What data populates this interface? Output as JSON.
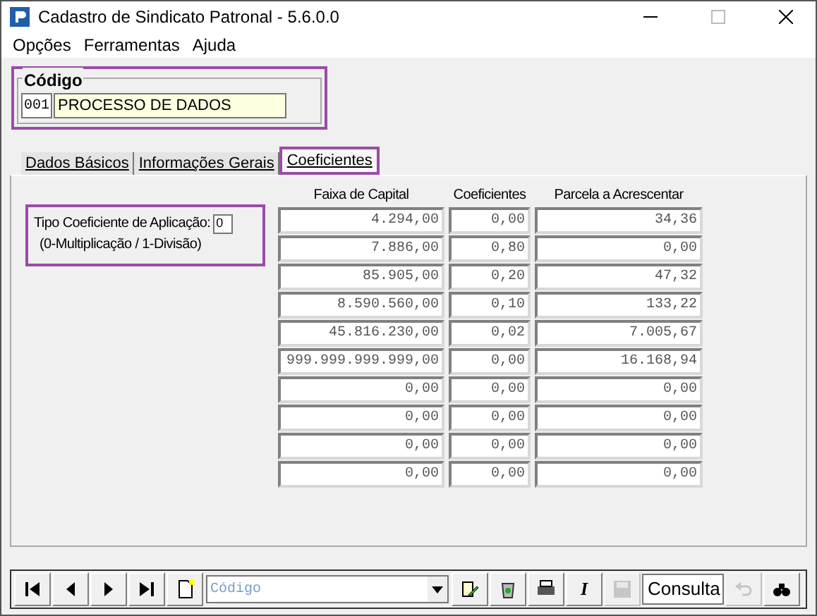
{
  "window": {
    "title": "Cadastro de Sindicato Patronal - 5.6.0.0"
  },
  "menu": [
    "Opções",
    "Ferramentas",
    "Ajuda"
  ],
  "codigo": {
    "label": "Código",
    "code": "001",
    "name": "PROCESSO DE DADOS"
  },
  "tabs": [
    {
      "label": "Dados Básicos",
      "selected": false
    },
    {
      "label": "Informações Gerais",
      "selected": false
    },
    {
      "label": "Coeficientes",
      "selected": true
    }
  ],
  "tipo": {
    "label": "Tipo Coeficiente de Aplicação:",
    "value": "0",
    "hint": "(0-Multiplicação / 1-Divisão)"
  },
  "table": {
    "columns": [
      "Faixa de Capital",
      "Coeficientes",
      "Parcela a Acrescentar"
    ],
    "rows": [
      [
        "4.294,00",
        "0,00",
        "34,36"
      ],
      [
        "7.886,00",
        "0,80",
        "0,00"
      ],
      [
        "85.905,00",
        "0,20",
        "47,32"
      ],
      [
        "8.590.560,00",
        "0,10",
        "133,22"
      ],
      [
        "45.816.230,00",
        "0,02",
        "7.005,67"
      ],
      [
        "999.999.999.999,00",
        "0,00",
        "16.168,94"
      ],
      [
        "0,00",
        "0,00",
        "0,00"
      ],
      [
        "0,00",
        "0,00",
        "0,00"
      ],
      [
        "0,00",
        "0,00",
        "0,00"
      ],
      [
        "0,00",
        "0,00",
        "0,00"
      ]
    ]
  },
  "toolbar": {
    "search_placeholder": "Código",
    "mode": "Consulta",
    "italic_label": "I",
    "buttons": [
      {
        "kind": "first",
        "disabled": false
      },
      {
        "kind": "prev",
        "disabled": false
      },
      {
        "kind": "next",
        "disabled": false
      },
      {
        "kind": "last",
        "disabled": false
      },
      {
        "kind": "new",
        "disabled": false
      },
      {
        "kind": "search"
      },
      {
        "kind": "edit",
        "disabled": false
      },
      {
        "kind": "recycle",
        "disabled": false
      },
      {
        "kind": "print",
        "disabled": false
      },
      {
        "kind": "italic",
        "disabled": false
      },
      {
        "kind": "save",
        "disabled": true
      },
      {
        "kind": "mode"
      },
      {
        "kind": "undo",
        "disabled": true
      },
      {
        "kind": "find",
        "disabled": false
      }
    ]
  }
}
